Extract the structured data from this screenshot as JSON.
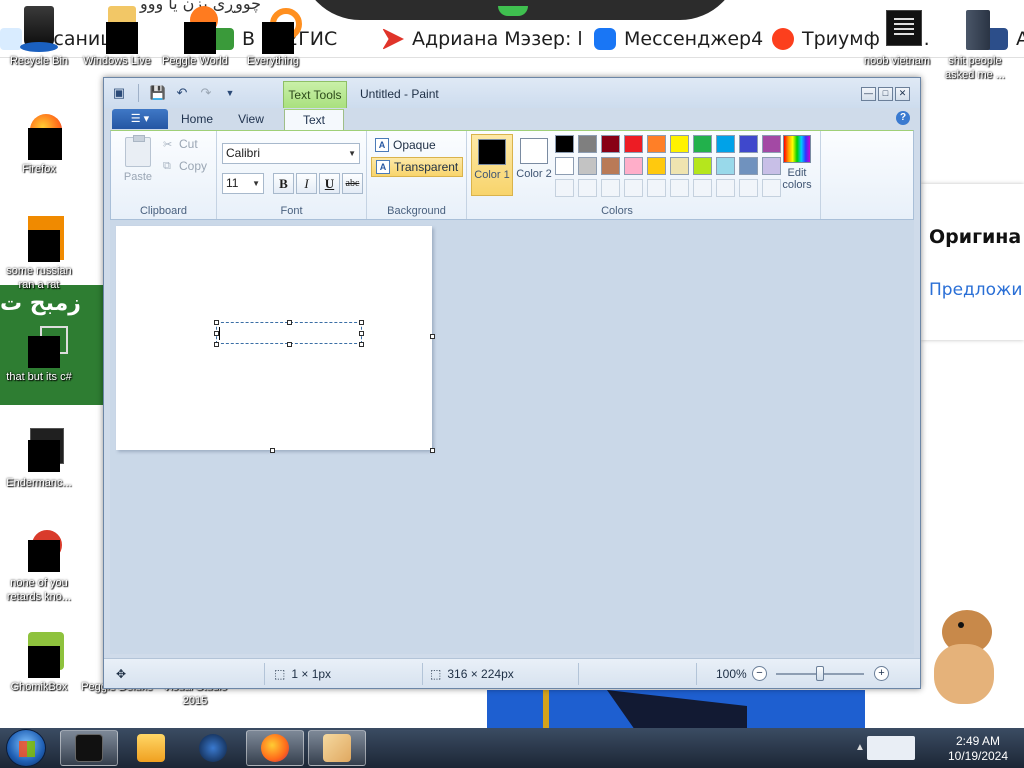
{
  "browser": {
    "arabic_top": "چووڕی بزن یا ووو",
    "bookmarks": [
      {
        "label": "ts саница",
        "color": "#d9ecff"
      },
      {
        "label": "В — 2ГИС",
        "color": "#3a9a3a"
      },
      {
        "label": "Адриана Мэзер: l",
        "color": "#e0342a"
      },
      {
        "label": "Мессенджер4",
        "color": "#1976f5"
      },
      {
        "label": "Триумф ыта.",
        "color": "#fc3f1d"
      },
      {
        "label": "A",
        "color": "#2c4e8a"
      }
    ],
    "right_card_title": "Оригина",
    "right_card_link": "Предложи",
    "green_banner_text": "زمبح ت"
  },
  "desktop_icons": [
    {
      "label": "Recycle Bin",
      "color": "#2a2a2a"
    },
    {
      "label": "Windows Live",
      "color": "#e8b84a"
    },
    {
      "label": "Peggle World",
      "color": "#ff7b1f"
    },
    {
      "label": "Everything",
      "color": "#ff8f1f"
    },
    {
      "label": "noob vietnam",
      "color": "#111111"
    },
    {
      "label": "shit people asked me ...",
      "color": "#2f3a4a"
    },
    {
      "label": "Firefox",
      "color": "#ff7a1a"
    },
    {
      "label": "some russian ran a rat",
      "color": "#f08a00"
    },
    {
      "label": "that but its c#",
      "color": "#2e7d32"
    },
    {
      "label": "Endermanc...",
      "color": "#202020"
    },
    {
      "label": "none of you retards kno...",
      "color": "#d93b2b"
    },
    {
      "label": "GhomikBox",
      "color": "#7a5a2a"
    },
    {
      "label": "Peggle Deluxe",
      "color": "#6b4bb0"
    },
    {
      "label": "Visual Studio 2015",
      "color": "#68217a"
    }
  ],
  "paint": {
    "title": "Untitled - Paint",
    "context_tab": "Text Tools",
    "tabs": {
      "home": "Home",
      "view": "View",
      "text": "Text"
    },
    "help": "?",
    "clipboard": {
      "paste": "Paste",
      "cut": "Cut",
      "copy": "Copy",
      "group": "Clipboard"
    },
    "font": {
      "name": "Calibri",
      "size": "11",
      "bold": "B",
      "italic": "I",
      "underline": "U",
      "strike": "abc",
      "group": "Font"
    },
    "background": {
      "opaque": "Opaque",
      "transparent": "Transparent",
      "group": "Background"
    },
    "colors": {
      "color1_label": "Color 1",
      "color2_label": "Color 2",
      "color1": "#000000",
      "color2": "#ffffff",
      "edit_label": "Edit colors",
      "group": "Colors",
      "palette_row1": [
        "#000000",
        "#7f7f7f",
        "#880015",
        "#ed1c24",
        "#ff7f27",
        "#fff200",
        "#22b14c",
        "#00a2e8",
        "#3f48cc",
        "#a349a4"
      ],
      "palette_row2": [
        "#ffffff",
        "#c3c3c3",
        "#b97a57",
        "#ffaec9",
        "#ffc90e",
        "#efe4b0",
        "#b5e61d",
        "#99d9ea",
        "#7092be",
        "#c8bfe7"
      ]
    },
    "status": {
      "selection": "1 × 1px",
      "canvas_size": "316 × 224px",
      "zoom": "100%",
      "zoom_out": "−",
      "zoom_in": "+"
    }
  },
  "taskbar": {
    "time": "2:49 AM",
    "date": "10/19/2024"
  }
}
